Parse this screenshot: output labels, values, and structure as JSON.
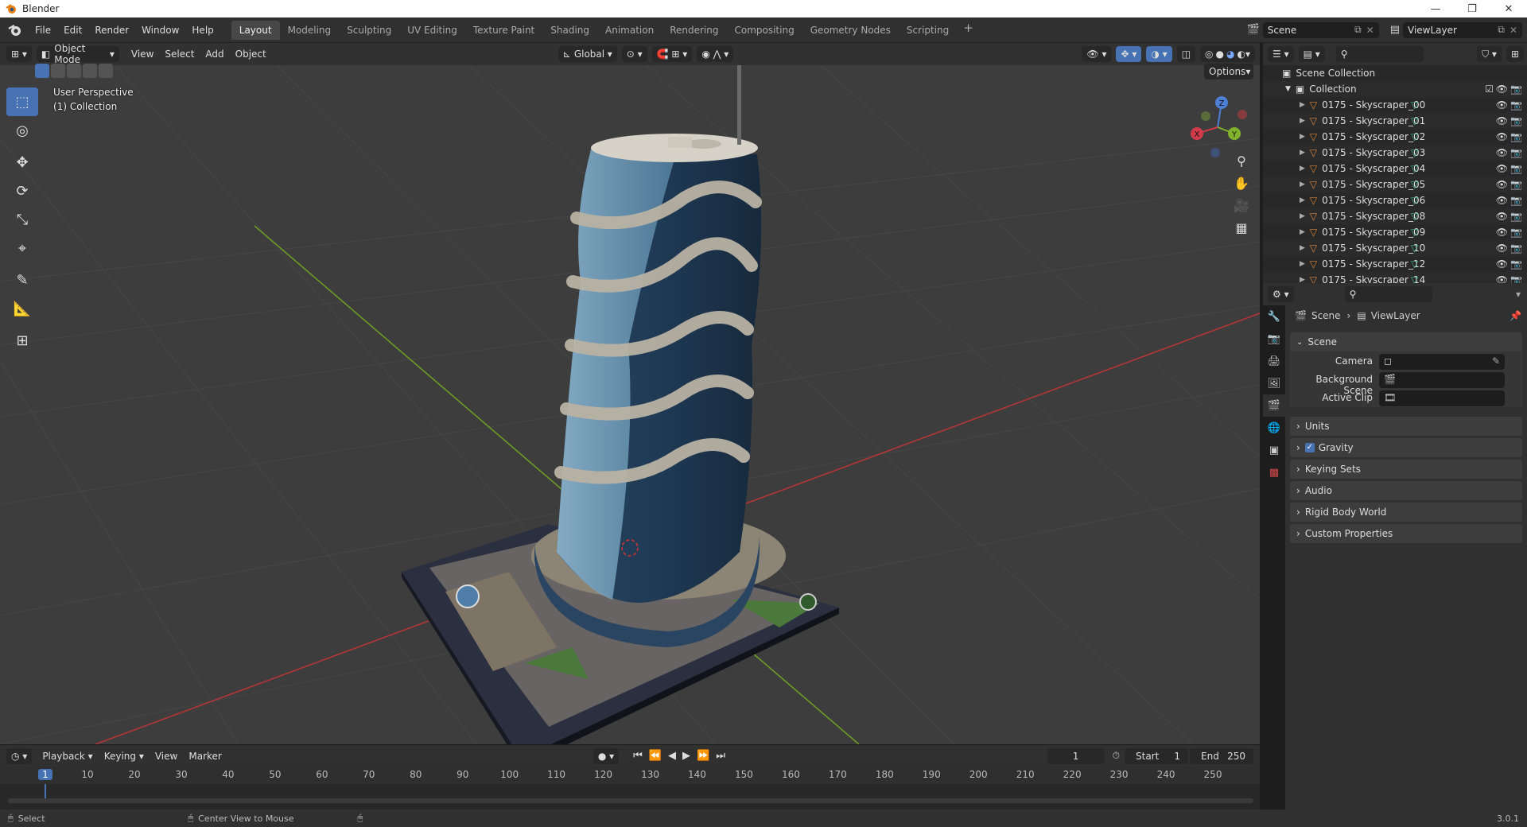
{
  "window": {
    "title": "Blender",
    "controls": [
      "—",
      "❐",
      "✕"
    ]
  },
  "menubar": {
    "items": [
      "File",
      "Edit",
      "Render",
      "Window",
      "Help"
    ]
  },
  "workspaces": {
    "tabs": [
      "Layout",
      "Modeling",
      "Sculpting",
      "UV Editing",
      "Texture Paint",
      "Shading",
      "Animation",
      "Rendering",
      "Compositing",
      "Geometry Nodes",
      "Scripting"
    ],
    "active": "Layout",
    "add": "+"
  },
  "scene_selector": {
    "value": "Scene"
  },
  "viewlayer_selector": {
    "value": "ViewLayer"
  },
  "viewport_header": {
    "mode": "Object Mode",
    "menus": [
      "View",
      "Select",
      "Add",
      "Object"
    ],
    "orientation": "Global",
    "options": "Options"
  },
  "viewport": {
    "perspective_label": "User Perspective",
    "collection_label": "(1) Collection",
    "gizmo": {
      "x": "X",
      "y": "Y",
      "z": "Z"
    },
    "colors": {
      "bg": "#3d3d3d",
      "x_axis": "#c23a3a",
      "y_axis": "#6f9b26",
      "grid": "#4a4a4a"
    }
  },
  "outliner": {
    "root": "Scene Collection",
    "collection": "Collection",
    "items": [
      "0175 - Skyscraper_00",
      "0175 - Skyscraper_01",
      "0175 - Skyscraper_02",
      "0175 - Skyscraper_03",
      "0175 - Skyscraper_04",
      "0175 - Skyscraper_05",
      "0175 - Skyscraper_06",
      "0175 - Skyscraper_08",
      "0175 - Skyscraper_09",
      "0175 - Skyscraper_10",
      "0175 - Skyscraper_12",
      "0175 - Skyscraper_14"
    ]
  },
  "properties": {
    "breadcrumb": {
      "scene": "Scene",
      "viewlayer": "ViewLayer"
    },
    "scene_panel": {
      "title": "Scene",
      "camera_label": "Camera",
      "background_scene_label": "Background Scene",
      "active_clip_label": "Active Clip"
    },
    "panels": [
      "Units",
      "Gravity",
      "Keying Sets",
      "Audio",
      "Rigid Body World",
      "Custom Properties"
    ],
    "gravity_checked": true
  },
  "timeline": {
    "menus": [
      "Playback",
      "Keying",
      "View",
      "Marker"
    ],
    "current_frame": "1",
    "start_label": "Start",
    "start_value": "1",
    "end_label": "End",
    "end_value": "250",
    "ruler": [
      "1",
      "10",
      "20",
      "30",
      "40",
      "50",
      "60",
      "70",
      "80",
      "90",
      "100",
      "110",
      "120",
      "130",
      "140",
      "150",
      "160",
      "170",
      "180",
      "190",
      "200",
      "210",
      "220",
      "230",
      "240",
      "250"
    ]
  },
  "statusbar": {
    "select": "Select",
    "center_view": "Center View to Mouse",
    "version": "3.0.1"
  }
}
